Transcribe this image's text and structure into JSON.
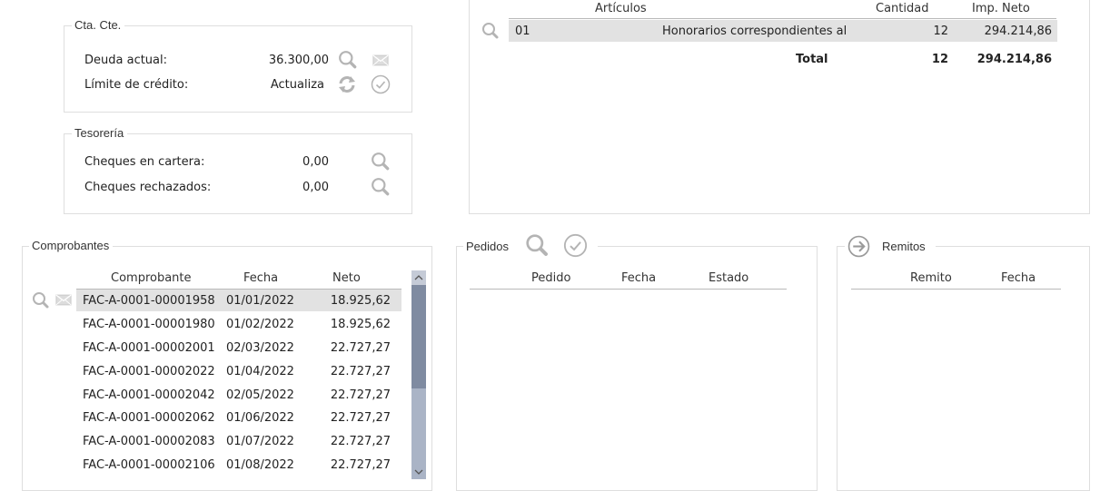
{
  "ctacte": {
    "title": "Cta. Cte.",
    "deuda_label": "Deuda actual:",
    "deuda_value": "36.300,00",
    "limite_label": "Límite de crédito:",
    "limite_value": "Actualiza"
  },
  "tesoreria": {
    "title": "Tesorería",
    "cartera_label": "Cheques en cartera:",
    "cartera_value": "0,00",
    "rechazados_label": "Cheques rechazados:",
    "rechazados_value": "0,00"
  },
  "articulos": {
    "headers": {
      "articulo": "Artículos",
      "cantidad": "Cantidad",
      "imp_neto": "Imp. Neto"
    },
    "rows": [
      {
        "codigo": "01",
        "descripcion": "Honorarios correspondientes al",
        "cantidad": "12",
        "imp_neto": "294.214,86"
      }
    ],
    "total": {
      "label": "Total",
      "cantidad": "12",
      "imp_neto": "294.214,86"
    }
  },
  "comprobantes": {
    "title": "Comprobantes",
    "headers": {
      "comprobante": "Comprobante",
      "fecha": "Fecha",
      "neto": "Neto"
    },
    "rows": [
      {
        "comprobante": "FAC-A-0001-00001958",
        "fecha": "01/01/2022",
        "neto": "18.925,62"
      },
      {
        "comprobante": "FAC-A-0001-00001980",
        "fecha": "01/02/2022",
        "neto": "18.925,62"
      },
      {
        "comprobante": "FAC-A-0001-00002001",
        "fecha": "02/03/2022",
        "neto": "22.727,27"
      },
      {
        "comprobante": "FAC-A-0001-00002022",
        "fecha": "01/04/2022",
        "neto": "22.727,27"
      },
      {
        "comprobante": "FAC-A-0001-00002042",
        "fecha": "02/05/2022",
        "neto": "22.727,27"
      },
      {
        "comprobante": "FAC-A-0001-00002062",
        "fecha": "01/06/2022",
        "neto": "22.727,27"
      },
      {
        "comprobante": "FAC-A-0001-00002083",
        "fecha": "01/07/2022",
        "neto": "22.727,27"
      },
      {
        "comprobante": "FAC-A-0001-00002106",
        "fecha": "01/08/2022",
        "neto": "22.727,27"
      }
    ]
  },
  "pedidos": {
    "title": "Pedidos",
    "headers": {
      "pedido": "Pedido",
      "fecha": "Fecha",
      "estado": "Estado"
    }
  },
  "remitos": {
    "title": "Remitos",
    "headers": {
      "remito": "Remito",
      "fecha": "Fecha"
    }
  },
  "icons": {
    "search": "search-icon",
    "mail": "mail-icon",
    "refresh": "refresh-icon",
    "check": "check-circle-icon",
    "arrow": "arrow-right-circle-icon"
  },
  "colors": {
    "icon_gray": "#b4b4b4",
    "selected_row": "#e2e2e2",
    "scrollbar_track": "#aab4c6",
    "scrollbar_thumb": "#7f8ba1"
  }
}
